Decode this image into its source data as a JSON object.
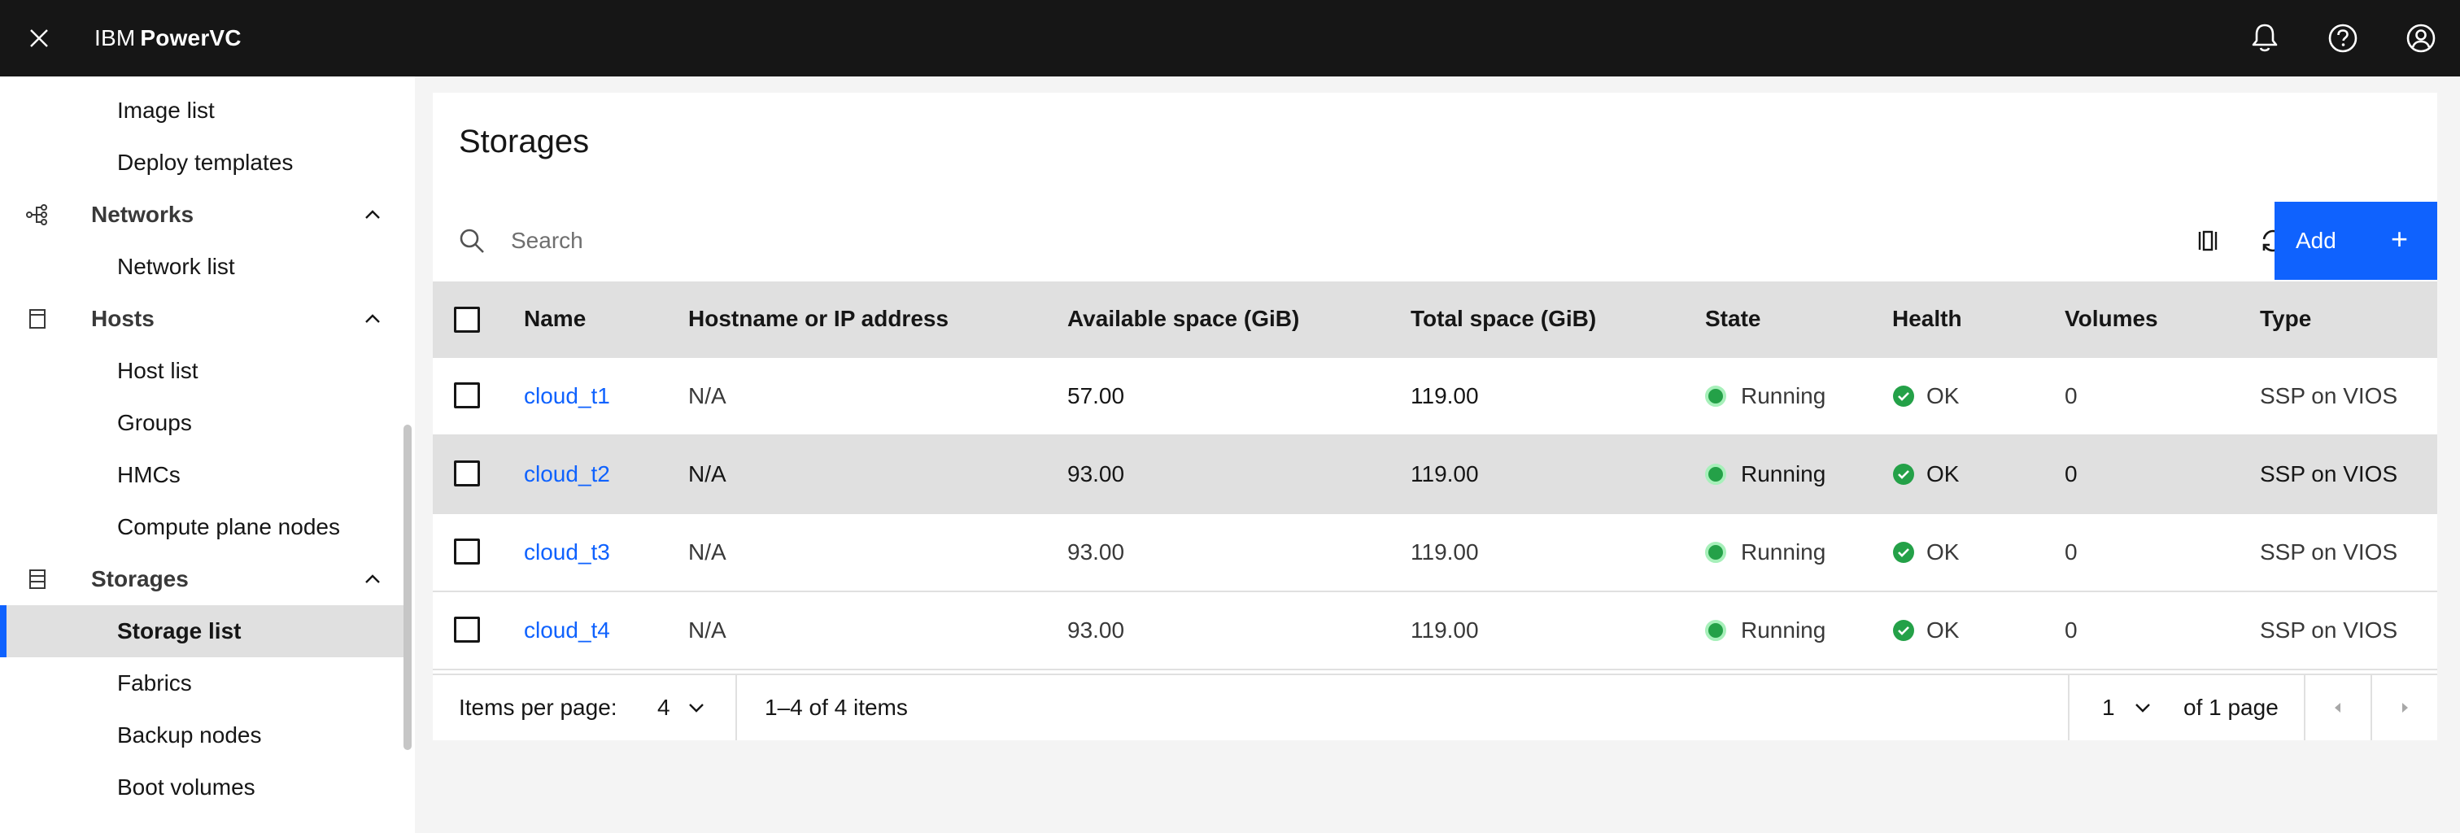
{
  "header": {
    "brand_ibm": "IBM",
    "brand_product": "PowerVC"
  },
  "sidebar": {
    "items": [
      {
        "label": "Image list",
        "kind": "sub"
      },
      {
        "label": "Deploy templates",
        "kind": "sub"
      },
      {
        "label": "Networks",
        "kind": "group",
        "icon": "network-icon"
      },
      {
        "label": "Network list",
        "kind": "sub"
      },
      {
        "label": "Hosts",
        "kind": "group",
        "icon": "host-icon"
      },
      {
        "label": "Host list",
        "kind": "sub"
      },
      {
        "label": "Groups",
        "kind": "sub"
      },
      {
        "label": "HMCs",
        "kind": "sub"
      },
      {
        "label": "Compute plane nodes",
        "kind": "sub"
      },
      {
        "label": "Storages",
        "kind": "group",
        "icon": "storage-icon"
      },
      {
        "label": "Storage list",
        "kind": "sub",
        "active": true
      },
      {
        "label": "Fabrics",
        "kind": "sub"
      },
      {
        "label": "Backup nodes",
        "kind": "sub"
      },
      {
        "label": "Boot volumes",
        "kind": "sub"
      }
    ]
  },
  "main": {
    "title": "Storages",
    "search": {
      "placeholder": "Search",
      "value": ""
    },
    "add_label": "Add",
    "table": {
      "columns": [
        "Name",
        "Hostname or IP address",
        "Available space (GiB)",
        "Total space (GiB)",
        "State",
        "Health",
        "Volumes",
        "Type"
      ],
      "rows": [
        {
          "name": "cloud_t1",
          "host": "N/A",
          "available": "57.00",
          "total": "119.00",
          "state": "Running",
          "health": "OK",
          "volumes": "0",
          "type": "SSP on VIOS"
        },
        {
          "name": "cloud_t2",
          "host": "N/A",
          "available": "93.00",
          "total": "119.00",
          "state": "Running",
          "health": "OK",
          "volumes": "0",
          "type": "SSP on VIOS"
        },
        {
          "name": "cloud_t3",
          "host": "N/A",
          "available": "93.00",
          "total": "119.00",
          "state": "Running",
          "health": "OK",
          "volumes": "0",
          "type": "SSP on VIOS"
        },
        {
          "name": "cloud_t4",
          "host": "N/A",
          "available": "93.00",
          "total": "119.00",
          "state": "Running",
          "health": "OK",
          "volumes": "0",
          "type": "SSP on VIOS"
        }
      ]
    },
    "pagination": {
      "items_per_page_label": "Items per page:",
      "items_per_page_value": "4",
      "range_text": "1–4 of 4 items",
      "page_value": "1",
      "of_pages_text": "of 1 page"
    }
  },
  "colors": {
    "accent": "#0f62fe",
    "header_bg": "#161616",
    "status_ok": "#24a148"
  }
}
